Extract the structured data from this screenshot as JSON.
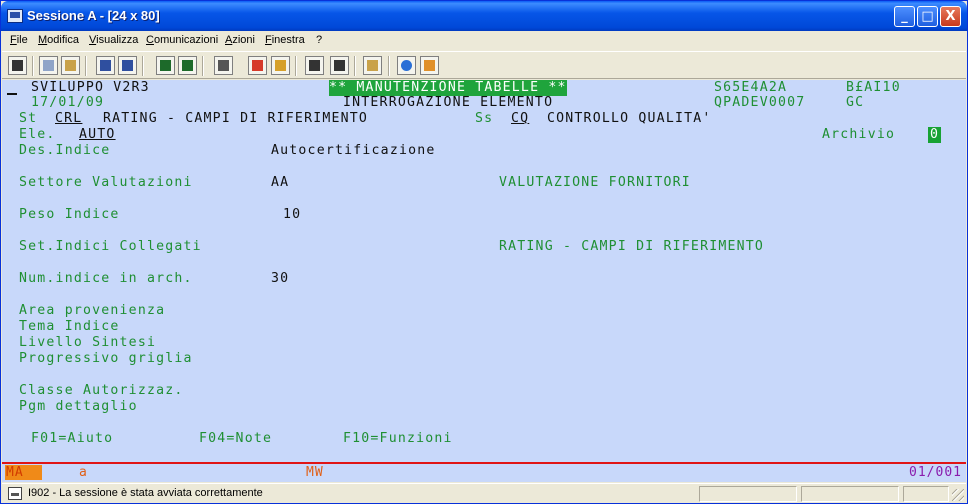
{
  "window": {
    "title": "Sessione A - [24 x 80]",
    "controls": {
      "minimize": "_",
      "maximize": "□",
      "close": "X"
    }
  },
  "menubar": {
    "items": [
      "File",
      "Modifica",
      "Visualizza",
      "Comunicazioni",
      "Azioni",
      "Finestra",
      "?"
    ]
  },
  "toolbar": {
    "buttons": [
      "print-screen",
      "copy",
      "paste",
      "send",
      "receive",
      "display",
      "keyboard",
      "record-macro",
      "play-macro",
      "macro-settings",
      "macro-save",
      "clipboard",
      "globe",
      "edit"
    ]
  },
  "colors": {
    "screen_bg": "#c8d8fa",
    "field_green": "#1f8f33",
    "text_dark": "#111111",
    "inverse_green": "#1fa43c",
    "oia_red": "#e01515",
    "oia_orange": "#f08a18",
    "oia_purple": "#8a1cad"
  },
  "screen": {
    "line1_left": "SVILUPPO V2R3",
    "line1_banner": "** MANUTENZIONE TABELLE **",
    "line1_code": "S65E4A2A",
    "line1_user": "B£AI10",
    "line2_date": "17/01/09",
    "line2_title": "INTERROGAZIONE ELEMENTO",
    "line2_program": "QPADEV0007",
    "line2_suffix": "GC",
    "line3_st_label": "St",
    "line3_st_code": "CRL",
    "line3_st_desc": "RATING - CAMPI DI RIFERIMENTO",
    "line3_ss_label": "Ss",
    "line3_ss_code": "CQ",
    "line3_ss_desc": "CONTROLLO QUALITA'",
    "ele_label": "Ele.",
    "ele_value": "AUTO",
    "archivio_label": "Archivio",
    "archivio_value": "0",
    "des_indice_label": "Des.Indice",
    "des_indice_value": "Autocertificazione",
    "settore_label": "Settore Valutazioni",
    "settore_value": "AA",
    "settore_desc": "VALUTAZIONE FORNITORI",
    "peso_label": "Peso Indice",
    "peso_value": "10",
    "set_indici_label": "Set.Indici Collegati",
    "set_indici_desc": "RATING - CAMPI DI RIFERIMENTO",
    "num_indice_label": "Num.indice in arch.",
    "num_indice_value": "30",
    "area_label": "Area provenienza",
    "tema_label": "Tema Indice",
    "livello_label": "Livello Sintesi",
    "progressivo_label": "Progressivo griglia",
    "classe_label": "Classe Autorizzaz.",
    "pgm_label": "Pgm dettaglio",
    "fkeys": [
      "F01=Aiuto",
      "F04=Note",
      "F10=Funzioni"
    ]
  },
  "oia": {
    "mode": "MA",
    "indicator": "a",
    "mw": "MW",
    "cursor_pos": "01/001"
  },
  "statusbar": {
    "message": "I902 - La sessione è stata avviata correttamente"
  }
}
